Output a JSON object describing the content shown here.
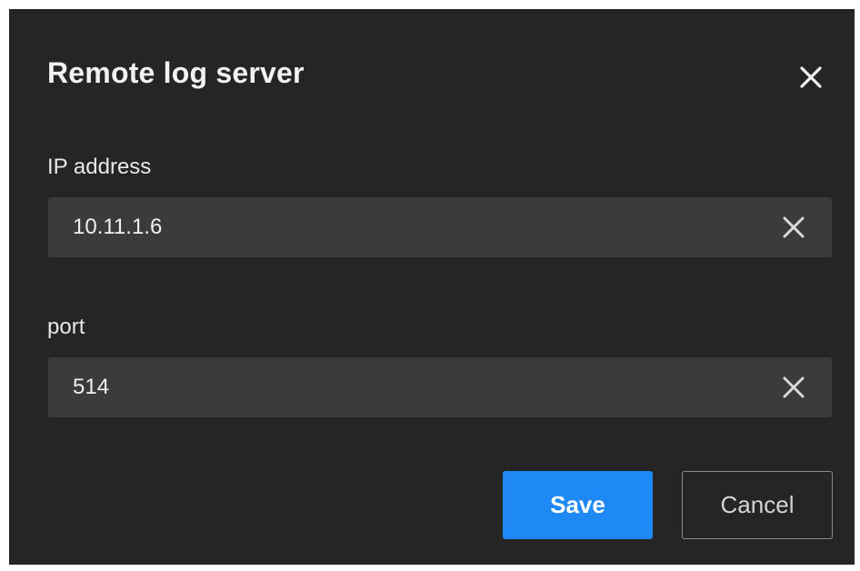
{
  "dialog": {
    "title": "Remote log server",
    "close_icon": "close-icon"
  },
  "fields": {
    "ip": {
      "label": "IP address",
      "value": "10.11.1.6",
      "clear_icon": "clear-icon"
    },
    "port": {
      "label": "port",
      "value": "514",
      "clear_icon": "clear-icon"
    }
  },
  "actions": {
    "save_label": "Save",
    "cancel_label": "Cancel"
  },
  "colors": {
    "dialog_background": "#252525",
    "input_background": "#3b3b3b",
    "primary_button": "#1e88f5",
    "text": "#ececec"
  }
}
